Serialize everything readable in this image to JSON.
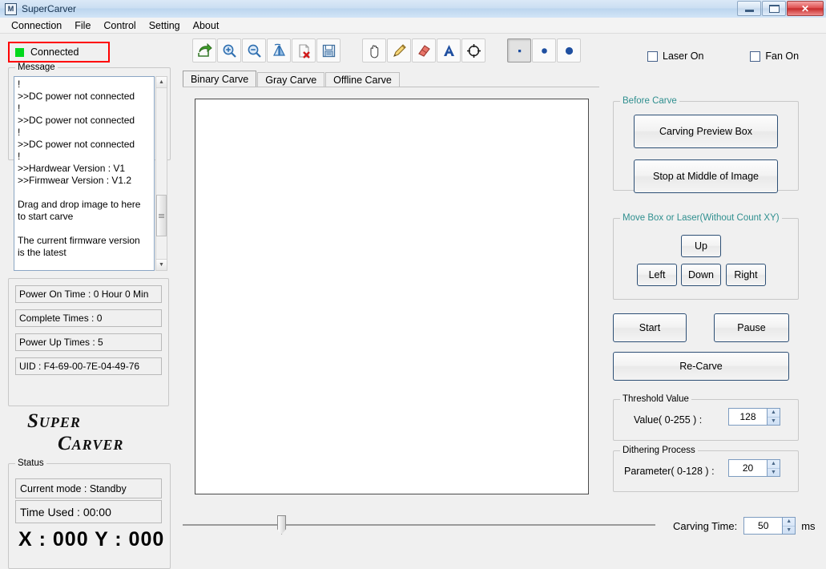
{
  "window": {
    "title": "SuperCarver",
    "icon": "app-icon",
    "buttons": {
      "minimize": "minimize",
      "maximize": "maximize",
      "close": "✕"
    }
  },
  "menu": {
    "items": [
      "Connection",
      "File",
      "Control",
      "Setting",
      "About"
    ]
  },
  "connection": {
    "status": "Connected",
    "indicator_color": "#00d81c",
    "highlight_color": "#ff0000"
  },
  "message": {
    "group_label": "Message",
    "text": "!\n>>DC power not connected\n!\n>>DC power not connected\n!\n>>DC power not connected\n!\n>>Hardwear Version : V1\n>>Firmwear Version : V1.2\n\nDrag and drop image to here\nto start carve\n\nThe current firmware version\nis the latest"
  },
  "info": {
    "rows": [
      "Power On Time : 0 Hour 0 Min",
      "Complete Times : 0",
      "Power Up Times : 5",
      "UID : F4-69-00-7E-04-49-76"
    ]
  },
  "logo": {
    "line1": "Super",
    "line2": "Carver"
  },
  "status": {
    "group_label": "Status",
    "current_mode": "Current mode : Standby",
    "time_used": "Time Used :  00:00",
    "coordinates": "X : 000  Y : 000"
  },
  "toolbar": {
    "buttons": [
      {
        "name": "open-image-icon",
        "title": "Open"
      },
      {
        "name": "zoom-in-icon",
        "title": "Zoom In"
      },
      {
        "name": "zoom-out-icon",
        "title": "Zoom Out"
      },
      {
        "name": "flip-image-icon",
        "title": "Flip"
      },
      {
        "name": "delete-file-icon",
        "title": "Delete"
      },
      {
        "name": "save-icon",
        "title": "Save"
      },
      {
        "name": "pan-hand-icon",
        "title": "Pan"
      },
      {
        "name": "pencil-icon",
        "title": "Pencil"
      },
      {
        "name": "eraser-icon",
        "title": "Eraser"
      },
      {
        "name": "text-tool-icon",
        "title": "Text"
      },
      {
        "name": "target-icon",
        "title": "Center"
      },
      {
        "name": "brush-small-icon",
        "title": "Small"
      },
      {
        "name": "brush-medium-icon",
        "title": "Medium"
      },
      {
        "name": "brush-large-icon",
        "title": "Large"
      }
    ]
  },
  "checkboxes": {
    "laser": {
      "label": "Laser On",
      "checked": false
    },
    "fan": {
      "label": "Fan On",
      "checked": false
    }
  },
  "tabs": {
    "items": [
      "Binary Carve",
      "Gray Carve",
      "Offline Carve"
    ],
    "active": "Binary Carve"
  },
  "before_carve": {
    "group_label": "Before Carve",
    "preview_button": "Carving Preview Box",
    "stop_middle_button": "Stop at Middle of Image"
  },
  "move_box": {
    "group_label": "Move Box or Laser(Without Count XY)",
    "up": "Up",
    "left": "Left",
    "down": "Down",
    "right": "Right"
  },
  "actions": {
    "start": "Start",
    "pause": "Pause",
    "recarve": "Re-Carve"
  },
  "threshold": {
    "group_label": "Threshold Value",
    "label": "Value( 0-255 ) :",
    "value": "128"
  },
  "dithering": {
    "group_label": "Dithering Process",
    "label": "Parameter( 0-128 ) :",
    "value": "20"
  },
  "carving_time": {
    "label": "Carving Time:",
    "value": "50",
    "unit": "ms",
    "slider_position_percent": 20
  },
  "colors": {
    "group_label_teal": "#2f8f8f",
    "button_border": "#2d4f75",
    "window_bg": "#f0f0f0"
  }
}
